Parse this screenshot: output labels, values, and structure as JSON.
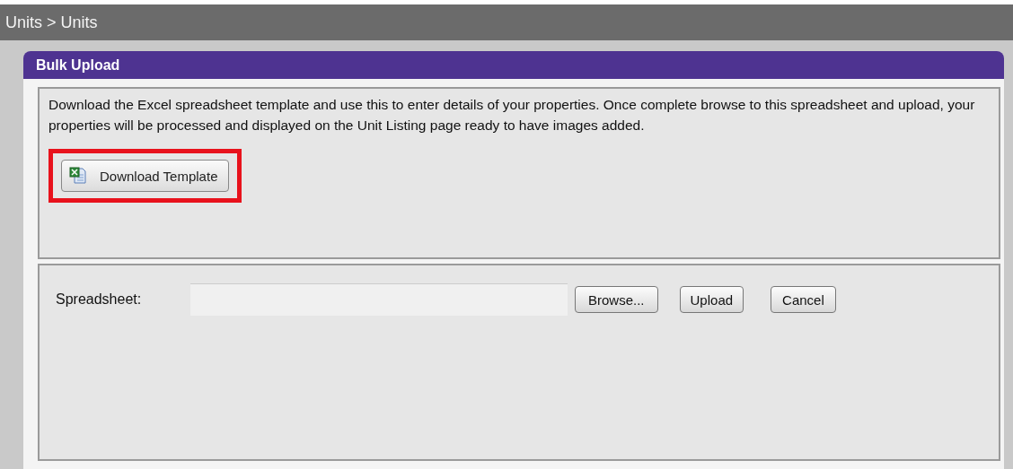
{
  "breadcrumb": "Units > Units",
  "panel": {
    "title": "Bulk Upload",
    "description": "Download the Excel spreadsheet template and use this to enter details of your properties. Once complete browse to this spreadsheet and upload, your properties will be processed and displayed on the Unit Listing page ready to have images added.",
    "download_button": {
      "label": "Download Template",
      "highlighted": true
    },
    "upload_form": {
      "label": "Spreadsheet:",
      "buttons": [
        "Browse...",
        "Upload",
        "Cancel"
      ]
    }
  }
}
